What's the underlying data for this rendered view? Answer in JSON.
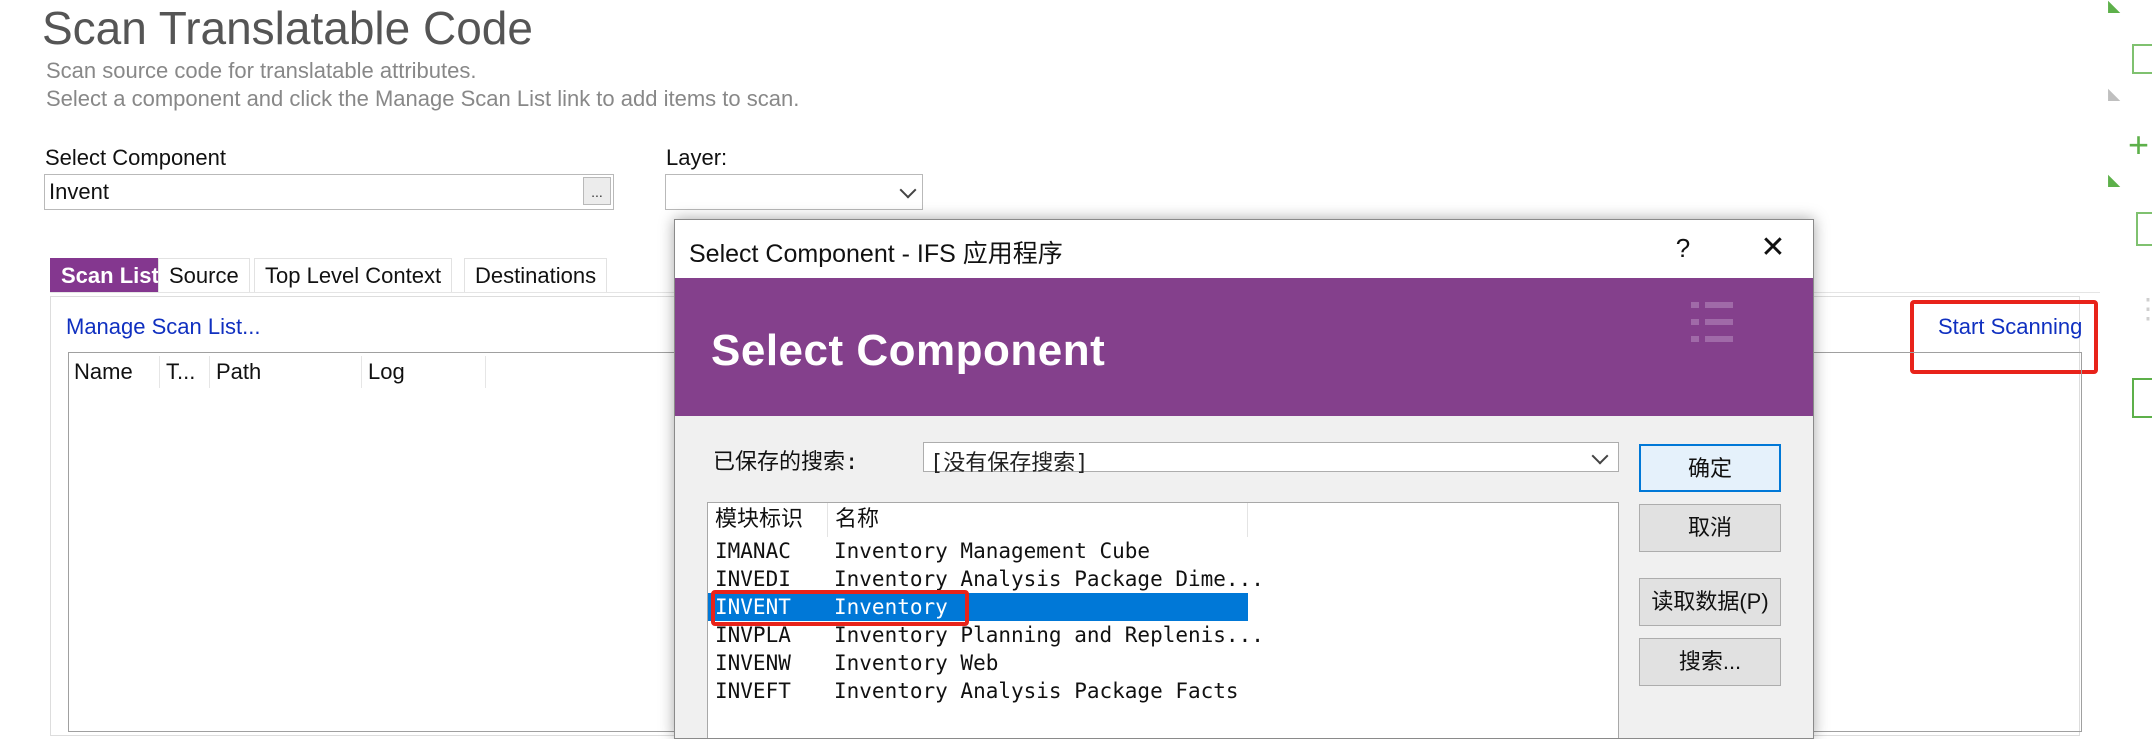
{
  "page": {
    "title": "Scan Translatable Code",
    "subtitle_line1": "Scan source code for translatable attributes.",
    "subtitle_line2": "Select a component and click the Manage Scan List link to add items to scan."
  },
  "form": {
    "component_label": "Select Component",
    "component_value": "Invent",
    "browse_label": "...",
    "layer_label": "Layer:",
    "layer_value": ""
  },
  "tabs": [
    {
      "label": "Scan List",
      "active": true
    },
    {
      "label": "Source",
      "active": false
    },
    {
      "label": "Top Level Context",
      "active": false
    },
    {
      "label": "Destinations",
      "active": false
    }
  ],
  "scan_list": {
    "manage_link": "Manage Scan List...",
    "start_link": "Start Scanning",
    "columns": [
      "Name",
      "T...",
      "Path",
      "Log"
    ]
  },
  "dialog": {
    "title": "Select Component - IFS 应用程序",
    "help": "?",
    "close": "✕",
    "heading": "Select Component",
    "saved_search_label": "已保存的搜索:",
    "saved_search_value": "[没有保存搜索]",
    "columns": [
      "模块标识",
      "名称"
    ],
    "rows": [
      {
        "id": "IMANAC",
        "name": "Inventory Management Cube",
        "selected": false
      },
      {
        "id": "INVEDI",
        "name": "Inventory Analysis Package Dime...",
        "selected": false
      },
      {
        "id": "INVENT",
        "name": "Inventory",
        "selected": true
      },
      {
        "id": "INVPLA",
        "name": "Inventory Planning and Replenis...",
        "selected": false
      },
      {
        "id": "INVENW",
        "name": "Inventory Web",
        "selected": false
      },
      {
        "id": "INVEFT",
        "name": "Inventory Analysis Package Facts",
        "selected": false
      }
    ],
    "buttons": {
      "ok": "确定",
      "cancel": "取消",
      "read_data": "读取数据(P)",
      "search": "搜索..."
    }
  },
  "colors": {
    "accent": "#84378f",
    "banner": "#84408c",
    "selection": "#0078d7",
    "highlight": "#e8231a",
    "link": "#1030c0",
    "side_icon": "#5db04a"
  }
}
